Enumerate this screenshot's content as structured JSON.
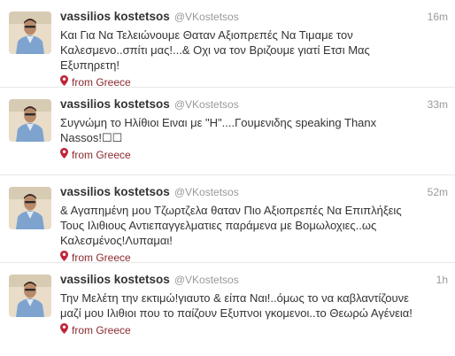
{
  "colors": {
    "name": "#333333",
    "meta": "#999999",
    "geo": "#8c2a2f"
  },
  "tweets": [
    {
      "fullname": "vassilios kostetsos",
      "username": "@VKostetsos",
      "time": "16m",
      "lines": [
        "Και Για Να Τελειώνουμε Θαταν Αξιοπρεπές Να Τιμαμε τον",
        "Καλεσμενο..σπίτι μας!...& Οχι να τον Βριζουμε γιατί Ετσι Μας",
        "Εξυπηρετη!"
      ],
      "place": "from Greece",
      "avatar_icon": "profile-photo"
    },
    {
      "fullname": "vassilios kostetsos",
      "username": "@VKostetsos",
      "time": "33m",
      "lines": [
        "Συγνώμη το Ηλίθιοι Ειναι με \"Η\"....Γουμενιδης speaking Thanx",
        "Nassos!☐☐"
      ],
      "place": "from Greece",
      "avatar_icon": "profile-photo"
    },
    {
      "fullname": "vassilios kostetsos",
      "username": "@VKostetsos",
      "time": "52m",
      "lines": [
        "& Αγαπημένη μου Τζωρτζελα θαταν Πιο Αξιοπρεπές Να Επιπλήξεις",
        "Τους Ιλιθιους Αντιεπαγγελματιες παράμενα με Βομωλοχιες..ως",
        "Καλεσμένος!Λυπαμαι!"
      ],
      "place": "from Greece",
      "avatar_icon": "profile-photo"
    },
    {
      "fullname": "vassilios kostetsos",
      "username": "@VKostetsos",
      "time": "1h",
      "lines": [
        "Την Μελέτη την εκτιμώ!γιαυτο & είπα Ναι!..όμως το να καβλαντίζουνε",
        "μαζί μου Ιλιθιοι που το παίζουν Εξυπνοι γκομενοι..το Θεωρώ Αγένεια!"
      ],
      "place": "from Greece",
      "avatar_icon": "profile-photo"
    }
  ]
}
